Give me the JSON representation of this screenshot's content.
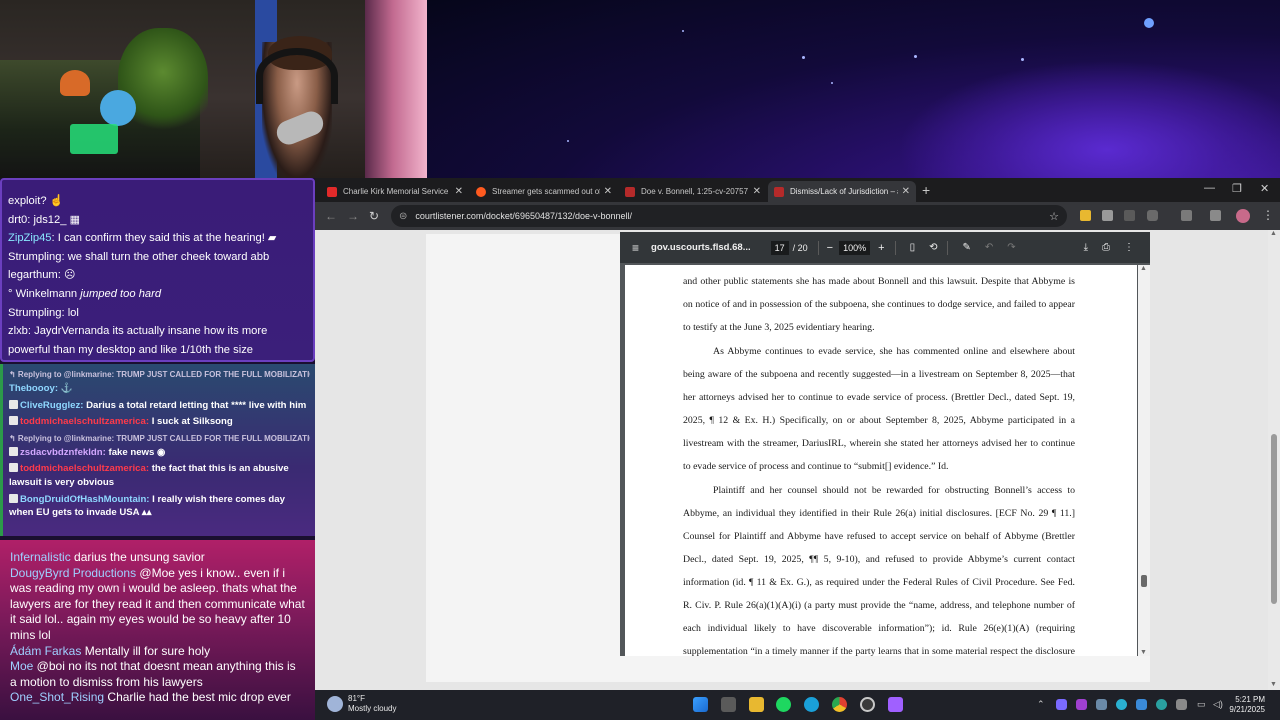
{
  "weather": {
    "temp": "81°F",
    "condition": "Mostly cloudy"
  },
  "chat_primary": [
    {
      "parts": [
        {
          "t": "exploit? ☝",
          "c": "u-white"
        }
      ]
    },
    {
      "parts": [
        {
          "t": "drt0: jds12_ ",
          "c": "u-white"
        },
        {
          "t": "▦",
          "c": "u-white"
        }
      ]
    },
    {
      "parts": [
        {
          "t": "ZipZip45",
          "c": "u-cyan"
        },
        {
          "t": ": I can confirm they said this at the hearing! ▰",
          "c": "u-white"
        }
      ]
    },
    {
      "parts": [
        {
          "t": "Strumpling: we shall turn the other cheek toward abb",
          "c": "u-white"
        }
      ]
    },
    {
      "parts": [
        {
          "t": "legarthum: ☹",
          "c": "u-white"
        }
      ]
    },
    {
      "parts": [
        {
          "t": "° Winkelmann ",
          "c": "u-white"
        },
        {
          "t": "jumped too hard",
          "c": "it"
        }
      ]
    },
    {
      "parts": [
        {
          "t": "Strumpling: lol",
          "c": "u-white"
        }
      ]
    },
    {
      "parts": [
        {
          "t": "zlxb: JaydrVernanda its actually insane how its more",
          "c": "u-white"
        }
      ]
    },
    {
      "parts": [
        {
          "t": "powerful than my desktop and like 1/10th the size",
          "c": "u-white"
        }
      ]
    }
  ],
  "chat_secondary": [
    {
      "reply": "↰ Replying to @linkmarine: TRUMP JUST CALLED FOR THE FULL MOBILIZATION OF ...",
      "user": "Theboooy:",
      "uc": "u-blue",
      "text": " ⚓",
      "badge": false
    },
    {
      "reply": "",
      "user": "CliveRugglez:",
      "uc": "u-blue",
      "text": " Darius a total retard letting that **** live with him",
      "badge": true
    },
    {
      "reply": "",
      "user": "toddmichaelschultzamerica:",
      "uc": "u-red",
      "text": " I suck at Silksong",
      "badge": true
    },
    {
      "reply": "↰ Replying to @linkmarine: TRUMP JUST CALLED FOR THE FULL MOBILIZATION OF ...",
      "user": "zsdacvbdznfekldn:",
      "uc": "u-purple",
      "text": " fake news ◉",
      "badge": true
    },
    {
      "reply": "",
      "user": "toddmichaelschultzamerica:",
      "uc": "u-red",
      "text": " the fact that this is an abusive lawsuit is very obvious",
      "badge": true
    },
    {
      "reply": "",
      "user": "BongDruidOfHashMountain:",
      "uc": "u-blue",
      "text": " I really wish there comes day when EU gets to invade USA ▴▴",
      "badge": true
    }
  ],
  "chat_tertiary": [
    {
      "user": "Infernalistic",
      "text": " darius the unsung savior"
    },
    {
      "user": "DougyByrd Productions",
      "text": " @Moe yes i know.. even if i was reading my own i would be asleep. thats what the lawyers are for they read it and then communicate what it said lol.. again my eyes would be so heavy after 10 mins lol"
    },
    {
      "user": "Ádám Farkas",
      "text": " Mentally ill for sure holy"
    },
    {
      "user": "Moe",
      "text": " @boi no its not that doesnt mean anything this is a motion to dismiss from his lawyers"
    },
    {
      "user": "One_Shot_Rising",
      "text": " Charlie had the best mic drop ever"
    }
  ],
  "browser": {
    "tabs": [
      {
        "title": "Charlie Kirk Memorial Service -",
        "fav": "#e22a2a"
      },
      {
        "title": "Streamer gets scammed out of",
        "fav": "#ff5a1f"
      },
      {
        "title": "Doe v. Bonnell, 1:25-cv-20757 -",
        "fav": "#b52a2a"
      },
      {
        "title": "Dismiss/Lack of Jurisdiction – #",
        "fav": "#b52a2a"
      }
    ],
    "new_tab": "+",
    "url": "courtlistener.com/docket/69650487/132/doe-v-bonnell/"
  },
  "pdf": {
    "file_name": "gov.uscourts.flsd.68...",
    "page_current": "17",
    "page_total": "/ 20",
    "zoom": "100%",
    "lines": [
      "and other public statements she has made about Bonnell and this lawsuit. Despite that Abbyme is",
      "on notice of and in possession of the subpoena, she continues to dodge service, and failed to appear",
      "to testify at the June 3, 2025 evidentiary hearing.",
      "As Abbyme continues to evade service, she has commented online and elsewhere about",
      "being aware of the subpoena and recently suggested—in a livestream on September 8, 2025—that",
      "her attorneys advised her to continue to evade service of process. (Brettler Decl., dated Sept. 19,",
      "2025, ¶ 12 & Ex. H.) Specifically, on or about September 8, 2025, Abbyme participated in a",
      "livestream with the streamer, DariusIRL, wherein she stated her attorneys advised her to continue",
      "to evade service of process and continue to “submit[] evidence.” Id.",
      "Plaintiff and her counsel should not be rewarded for obstructing Bonnell’s access to",
      "Abbyme, an individual they identified in their Rule 26(a) initial disclosures. [ECF No. 29 ¶ 11.]",
      "Counsel for Plaintiff and Abbyme have refused to accept service on behalf of Abbyme (Brettler",
      "Decl., dated Sept. 19, 2025, ¶¶ 5, 9-10), and refused to provide Abbyme’s current contact",
      "information (id. ¶ 11 & Ex. G.), as required under the Federal Rules of Civil Procedure. See Fed.",
      "R. Civ. P. Rule 26(a)(1)(A)(i) (a party must provide the “name, address, and telephone number of",
      "each individual likely to have discoverable information”); id. Rule 26(e)(1)(A) (requiring",
      "supplementation “in a timely manner if the party learns that in some material respect the disclosure"
    ]
  },
  "clock": {
    "time": "5:21 PM",
    "date": "9/21/2025"
  }
}
